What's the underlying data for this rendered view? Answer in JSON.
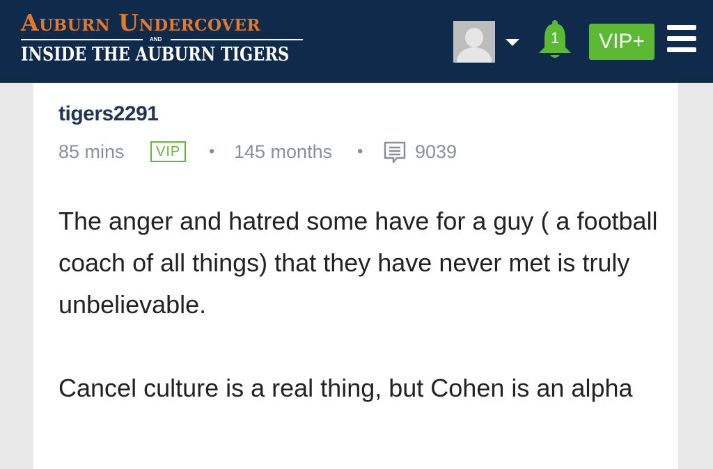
{
  "header": {
    "logo_line1": "Auburn Undercover",
    "logo_and": "AND",
    "logo_line2": "INSIDE THE AUBURN TIGERS",
    "notification_count": "1",
    "vip_button_label": "VIP+",
    "colors": {
      "background": "#0f2a4a",
      "logo_orange": "#e4782c",
      "accent_green": "#5cb934"
    }
  },
  "post": {
    "username": "tigers2291",
    "time_ago": "85 mins",
    "badge": "VIP",
    "separator": "•",
    "member_for": "145 months",
    "post_count": "9039",
    "icons": [
      "message-count-icon"
    ],
    "paragraph1": "The anger and hatred some have for a guy ( a football coach of all things) that they have never met is truly unbelievable.",
    "paragraph2": "Cancel culture is a real thing, but Cohen is an alpha"
  }
}
